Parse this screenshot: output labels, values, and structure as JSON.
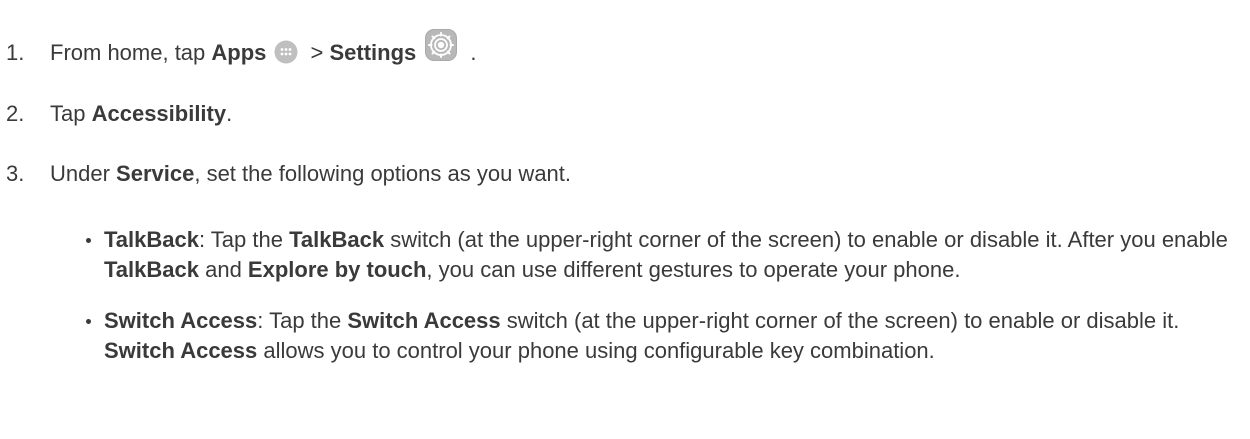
{
  "steps": {
    "s1": {
      "num": "1.",
      "t1": "From home, tap ",
      "b1": "Apps",
      "icon1": "apps-icon",
      "t2": " > ",
      "b2": "Settings",
      "icon2": "settings-gear-icon",
      "t3": " ."
    },
    "s2": {
      "num": "2.",
      "t1": "Tap ",
      "b1": "Accessibility",
      "t2": "."
    },
    "s3": {
      "num": "3.",
      "t1": "Under ",
      "b1": "Service",
      "t2": ", set the following options as you want."
    }
  },
  "bullets": {
    "talkback": {
      "b1": "TalkBack",
      "t1": ": Tap the ",
      "b2": "TalkBack",
      "t2": " switch (at the upper-right corner of the screen) to enable or disable it. After you enable ",
      "b3": "TalkBack",
      "t3": " and ",
      "b4": "Explore by touch",
      "t4": ", you can use different gestures to operate your phone."
    },
    "switch_access": {
      "b1": "Switch Access",
      "t1": ": Tap the ",
      "b2": "Switch Access",
      "t2": " switch (at the upper-right corner of the screen) to enable or disable it. ",
      "b3": "Switch Access",
      "t3": " allows you to control your phone using configurable key combination."
    }
  }
}
